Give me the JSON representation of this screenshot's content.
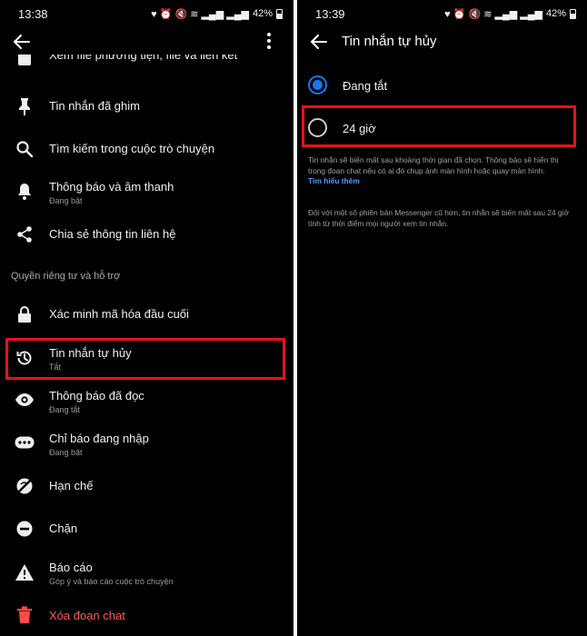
{
  "left": {
    "time": "13:38",
    "battery": "42%",
    "status_icons": "♥ ⏰ 🔇 ≋ ▂▄▆ ▂▄▆",
    "partial_item": "Xem file phương tiện, file và liên kết",
    "items": [
      {
        "label": "Tin nhắn đã ghim",
        "icon": "pin-icon"
      },
      {
        "label": "Tìm kiếm trong cuộc trò chuyện",
        "icon": "search-icon"
      },
      {
        "label": "Thông báo và âm thanh",
        "sub": "Đang bật",
        "icon": "bell-icon"
      },
      {
        "label": "Chia sẻ thông tin liên hệ",
        "icon": "share-icon"
      }
    ],
    "section_privacy": "Quyền riêng tư và hỗ trợ",
    "privacy_items": [
      {
        "label": "Xác minh mã hóa đầu cuối",
        "icon": "lock-icon"
      },
      {
        "label": "Tin nhắn tự hủy",
        "sub": "Tắt",
        "icon": "timer-icon"
      },
      {
        "label": "Thông báo đã đọc",
        "sub": "Đang tắt",
        "icon": "eye-icon"
      },
      {
        "label": "Chỉ báo đang nhập",
        "sub": "Đang bật",
        "icon": "typing-icon"
      },
      {
        "label": "Hạn chế",
        "icon": "restrict-icon"
      },
      {
        "label": "Chặn",
        "icon": "block-icon"
      },
      {
        "label": "Báo cáo",
        "sub": "Góp ý và báo cáo cuộc trò chuyện",
        "icon": "warning-icon"
      },
      {
        "label": "Xóa đoạn chat",
        "icon": "trash-icon"
      }
    ]
  },
  "right": {
    "time": "13:39",
    "battery": "42%",
    "status_icons": "♥ ⏰ 🔇 ≋ ▂▄▆ ▂▄▆",
    "title": "Tin nhắn tự hủy",
    "options": [
      {
        "label": "Đang tắt",
        "selected": true
      },
      {
        "label": "24 giờ",
        "selected": false
      }
    ],
    "note1": "Tin nhắn sẽ biến mất sau khoảng thời gian đã chọn. Thông báo sẽ hiển thị trong đoạn chat nếu có ai đó chụp ảnh màn hình hoặc quay màn hình.",
    "learn_more": "Tìm hiểu thêm",
    "note2": "Đối với một số phiên bản Messenger cũ hơn, tin nhắn sẽ biến mất sau 24 giờ tính từ thời điểm mọi người xem tin nhắn."
  },
  "colors": {
    "highlight": "#e3121c",
    "accent": "#1877f2",
    "danger": "#ff5a5a",
    "background": "#000000"
  }
}
